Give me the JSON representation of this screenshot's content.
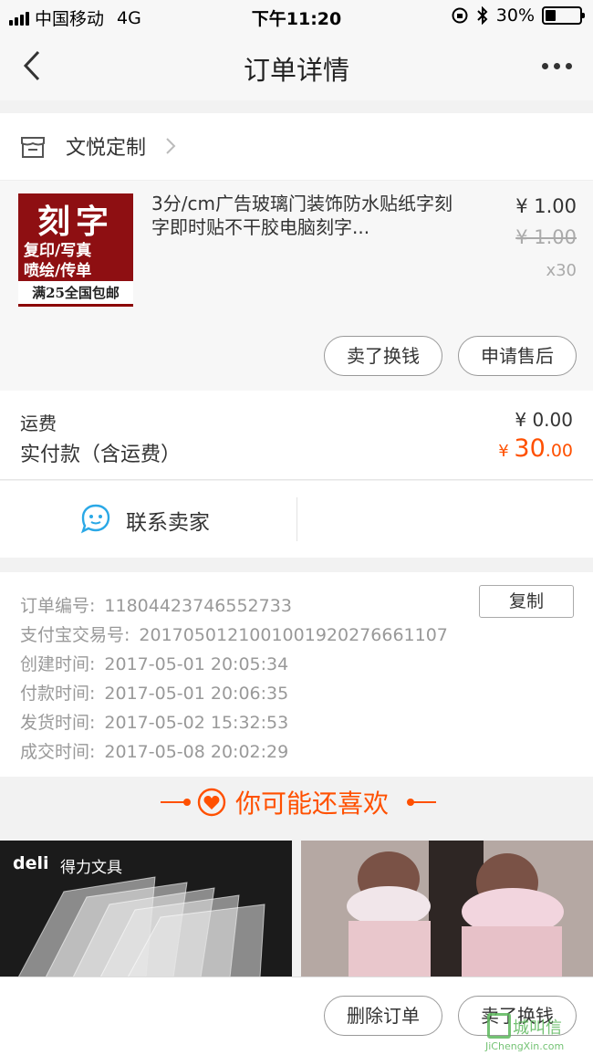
{
  "status_bar": {
    "carrier": "中国移动",
    "network": "4G",
    "time": "下午11:20",
    "battery_percent": "30%",
    "battery_level": 0.3
  },
  "nav": {
    "title": "订单详情",
    "back_icon": "chevron-left-icon",
    "more_icon": "more-dots-icon"
  },
  "shop": {
    "name": "文悦定制",
    "icon": "store-icon"
  },
  "product": {
    "image": {
      "headline": "刻字",
      "line1": "复印/写真",
      "line2": "喷绘/传单",
      "footer": "满25全国包邮"
    },
    "title": "3分/cm广告玻璃门装饰防水贴纸字刻字即时贴不干胶电脑刻字...",
    "price": "¥ 1.00",
    "original_price": "¥ 1.00",
    "quantity": "x30",
    "buttons": {
      "sell": "卖了换钱",
      "after_sales": "申请售后"
    }
  },
  "totals": {
    "shipping_label": "运费",
    "shipping_value": "¥ 0.00",
    "paid_label": "实付款（含运费）",
    "paid_currency": "¥ ",
    "paid_integer": "30",
    "paid_decimal": ".00"
  },
  "contact": {
    "label": "联系卖家",
    "icon": "chat-bubble-icon"
  },
  "order_info": {
    "copy_button": "复制",
    "rows": [
      {
        "key": "订单编号:",
        "value": "11804423746552733"
      },
      {
        "key": "支付宝交易号:",
        "value": "2017050121001001920276661107"
      },
      {
        "key": "创建时间:",
        "value": "2017-05-01 20:05:34"
      },
      {
        "key": "付款时间:",
        "value": "2017-05-01 20:06:35"
      },
      {
        "key": "发货时间:",
        "value": "2017-05-02 15:32:53"
      },
      {
        "key": "成交时间:",
        "value": "2017-05-08 20:02:29"
      }
    ]
  },
  "recommend": {
    "title": "你可能还喜欢",
    "icon": "heart-icon",
    "items": [
      {
        "brand": "deli",
        "brand_cn": "得力文具"
      },
      {
        "brand": "",
        "brand_cn": ""
      }
    ]
  },
  "bottom_bar": {
    "delete_order": "删除订单",
    "sell": "卖了换钱"
  },
  "watermark": {
    "text": "城叫信",
    "domain": "JiChengXin.com"
  },
  "colors": {
    "accent": "#ff5000",
    "text": "#333333",
    "muted": "#999999",
    "background": "#f2f2f2"
  }
}
